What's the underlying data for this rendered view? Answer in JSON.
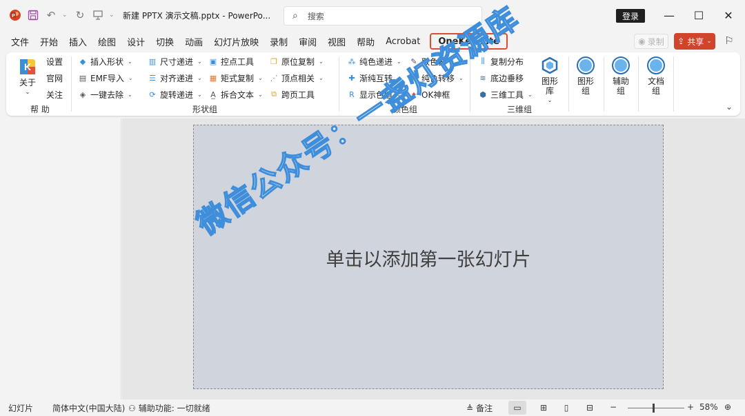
{
  "titlebar": {
    "doc_title": "新建 PPTX 演示文稿.pptx  -  PowerPo...",
    "search_placeholder": "搜索",
    "login_label": "登录",
    "minimize": "—",
    "maximize": "☐",
    "close": "✕"
  },
  "menu": {
    "tabs": [
      "文件",
      "开始",
      "插入",
      "绘图",
      "设计",
      "切换",
      "动画",
      "幻灯片放映",
      "录制",
      "审阅",
      "视图",
      "帮助",
      "Acrobat"
    ],
    "active_tab": "OneKey Lite",
    "record_label": "录制",
    "share_label": "共享"
  },
  "ribbon": {
    "help": {
      "about": "关于",
      "settings": "设置",
      "website": "官网",
      "follow": "关注",
      "label": "帮 助"
    },
    "shape": {
      "insert_shape": "插入形状",
      "emf_import": "EMF导入",
      "one_click_remove": "一键去除",
      "size_step": "尺寸递进",
      "align_step": "对齐递进",
      "rotate_step": "旋转递进",
      "control_point": "控点工具",
      "matrix_copy": "矩式复制",
      "split_text": "拆合文本",
      "in_place_copy": "原位复制",
      "vertex_related": "顶点相关",
      "cross_page": "跨页工具",
      "label": "形状组"
    },
    "color": {
      "pure_step": "纯色递进",
      "gradient_swap": "渐纯互转",
      "show_color": "显示色值",
      "picker": "取色器",
      "pure_convert": "纯色转移",
      "ok_frame": "OK神框",
      "label": "颜色组"
    },
    "three_d": {
      "copy_distribute": "复制分布",
      "base_perpendicular": "底边垂移",
      "three_d_tools": "三维工具",
      "label": "三维组"
    },
    "big": {
      "shape_lib": "图形库",
      "graphic_group": "图形组",
      "aux_group": "辅助组",
      "doc_group": "文档组"
    }
  },
  "slide": {
    "placeholder": "单击以添加第一张幻灯片",
    "watermark": "微信公众号：一盏灯资源库"
  },
  "status": {
    "slides": "幻灯片",
    "language": "简体中文(中国大陆)",
    "accessibility": "辅助功能: 一切就绪",
    "notes": "备注",
    "zoom": "58%"
  },
  "colors": {
    "accent_onekey_border": "#d8502e",
    "share_bg": "#d0442c",
    "slide_bg": "#d0d4dc"
  }
}
